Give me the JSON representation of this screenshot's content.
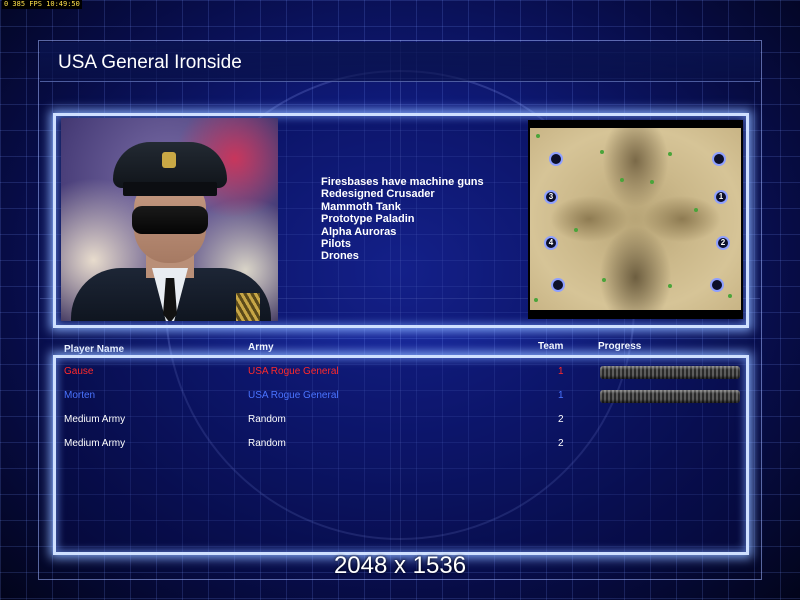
{
  "status_overlay": "0 385 FPS 10:49:50",
  "title": "USA General Ironside",
  "features": [
    "Firesbases have machine guns",
    "Redesigned Crusader",
    "Mammoth Tank",
    "Prototype Paladin",
    "Alpha Auroras",
    "Pilots",
    "Drones"
  ],
  "map": {
    "spawns": [
      "",
      "",
      "3",
      "1",
      "4",
      "2",
      "",
      ""
    ]
  },
  "table": {
    "headers": {
      "player_name": "Player Name",
      "army": "Army",
      "team": "Team",
      "progress": "Progress"
    },
    "rows": [
      {
        "name": "Gause",
        "army": "USA Rogue General",
        "team": "1",
        "color": "#ff2a2a",
        "progress": 1.0
      },
      {
        "name": "Morten",
        "army": "USA Rogue General",
        "team": "1",
        "color": "#4a74ff",
        "progress": 1.0
      },
      {
        "name": "Medium Army",
        "army": "Random",
        "team": "2",
        "color": "#ffffff"
      },
      {
        "name": "Medium Army",
        "army": "Random",
        "team": "2",
        "color": "#ffffff"
      }
    ]
  },
  "resolution_label": "2048 x 1536",
  "colors": {
    "panel_glow": "#cfe0ff",
    "background": "#0f1a7a"
  }
}
